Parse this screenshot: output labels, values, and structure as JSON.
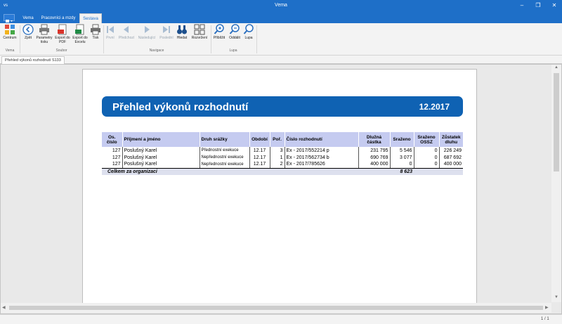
{
  "window": {
    "app_label": "vs",
    "title": "Vema",
    "controls": [
      "–",
      "❐",
      "✕"
    ]
  },
  "menu_tabs": [
    "Vema",
    "Pracovníci a mzdy",
    "Sestava"
  ],
  "ribbon": {
    "groups": [
      {
        "label": "Vema",
        "buttons": [
          {
            "label": "Centrum",
            "icon": "grid-icon"
          }
        ]
      },
      {
        "label": "Soubor",
        "buttons": [
          {
            "label": "Zpět",
            "icon": "back-arrow-icon"
          },
          {
            "label": "Parametry tisku",
            "icon": "print-settings-icon"
          },
          {
            "label": "Export do PDF",
            "icon": "pdf-export-icon"
          },
          {
            "label": "Export do Excelu",
            "icon": "excel-export-icon"
          },
          {
            "label": "Tisk",
            "icon": "printer-icon"
          }
        ]
      },
      {
        "label": "Navigace",
        "buttons": [
          {
            "label": "První",
            "icon": "first-page-icon",
            "disabled": true
          },
          {
            "label": "Předchozí",
            "icon": "previous-page-icon",
            "disabled": true
          },
          {
            "label": "Následující",
            "icon": "next-page-icon",
            "disabled": true
          },
          {
            "label": "Poslední",
            "icon": "last-page-icon",
            "disabled": true
          },
          {
            "label": "Hledat",
            "icon": "binoculars-icon"
          },
          {
            "label": "Rozvržení",
            "icon": "layout-icon"
          }
        ]
      },
      {
        "label": "Lupa",
        "buttons": [
          {
            "label": "Přiblížit",
            "icon": "zoom-in-icon"
          },
          {
            "label": "Oddálit",
            "icon": "zoom-out-icon"
          },
          {
            "label": "Lupa",
            "icon": "magnifier-icon"
          }
        ]
      }
    ]
  },
  "doc_tab": "Přehled výkonů rozhodnutí S133",
  "report": {
    "title": "Přehled výkonů rozhodnutí",
    "period": "12.2017",
    "columns": {
      "os_cislo": "Os. číslo",
      "jmeno": "Příjmení a jméno",
      "druh": "Druh srážky",
      "obdobi": "Období",
      "por": "Poř.",
      "cislo": "Číslo rozhodnutí",
      "dluzna": "Dlužná částka",
      "srazeno": "Sraženo",
      "ossz": "Sraženo OSSZ",
      "zustatek": "Zůstatek dluhu"
    },
    "rows": [
      {
        "os_cislo": "127",
        "jmeno": "Poslušný Karel",
        "druh": "Přednostní exekuce",
        "obdobi": "12.17",
        "por": "3",
        "cislo": "Ex - 2017/552214 p",
        "dluzna": "231 795",
        "srazeno": "5 546",
        "ossz": "0",
        "zustatek": "226 249"
      },
      {
        "os_cislo": "127",
        "jmeno": "Poslušný Karel",
        "druh": "Nepřednostní exekuce",
        "obdobi": "12.17",
        "por": "1",
        "cislo": "Ex - 2017/562734 b",
        "dluzna": "690 769",
        "srazeno": "3 077",
        "ossz": "0",
        "zustatek": "687 692"
      },
      {
        "os_cislo": "127",
        "jmeno": "Poslušný Karel",
        "druh": "Nepřednostní exekuce",
        "obdobi": "12.17",
        "por": "2",
        "cislo": "Ex - 2017/785626",
        "dluzna": "400 000",
        "srazeno": "0",
        "ossz": "0",
        "zustatek": "400 000"
      }
    ],
    "total_label": "Celkem za organizaci",
    "total_srazeno": "8 623"
  },
  "status": {
    "pages": "1 / 1"
  },
  "colors": {
    "accent": "#1e6fc8",
    "banner": "#0f62b3",
    "table_header": "#c5cbf0"
  }
}
